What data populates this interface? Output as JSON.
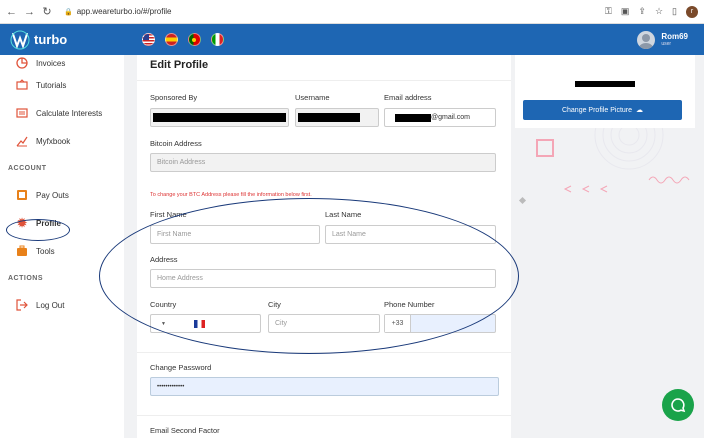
{
  "browser": {
    "url": "app.weareturbo.io/#/profile",
    "avatar_letter": "r"
  },
  "header": {
    "brand": "turbo",
    "flags": [
      "us-flag",
      "spain-flag",
      "portugal-flag",
      "italy-flag"
    ],
    "user_name": "Rom69",
    "user_role": "user"
  },
  "sidebar": {
    "items_top": [
      {
        "label": "Invoices",
        "icon": "invoice-icon"
      },
      {
        "label": "Tutorials",
        "icon": "tutorials-icon"
      },
      {
        "label": "Calculate Interests",
        "icon": "calculator-icon"
      },
      {
        "label": "Myfxbook",
        "icon": "chart-icon"
      }
    ],
    "account_title": "ACCOUNT",
    "items_account": [
      {
        "label": "Pay Outs",
        "icon": "payout-icon"
      },
      {
        "label": "Profile",
        "icon": "gear-icon"
      },
      {
        "label": "Tools",
        "icon": "toolbox-icon"
      }
    ],
    "actions_title": "ACTIONS",
    "logout": "Log Out"
  },
  "form": {
    "title": "Edit Profile",
    "sponsored_by_label": "Sponsored By",
    "username_label": "Username",
    "email_label": "Email address",
    "email_suffix": "@gmail.com",
    "bitcoin_label": "Bitcoin Address",
    "bitcoin_placeholder": "Bitcoin Address",
    "btc_note": "To change your BTC Address please fill the information below first.",
    "first_name_label": "First Name",
    "first_name_placeholder": "First Name",
    "last_name_label": "Last Name",
    "last_name_placeholder": "Last Name",
    "address_label": "Address",
    "address_placeholder": "Home Address",
    "country_label": "Country",
    "city_label": "City",
    "city_placeholder": "City",
    "phone_label": "Phone Number",
    "phone_code": "+33",
    "change_password_label": "Change Password",
    "password_value": "•••••••••••••",
    "second_factor_label": "Email Second Factor"
  },
  "right_panel": {
    "button": "Change Profile Picture"
  },
  "colors": {
    "brand_blue": "#1e66b3",
    "chat_green": "#1aa34a",
    "annotation": "#1a3a7a"
  }
}
